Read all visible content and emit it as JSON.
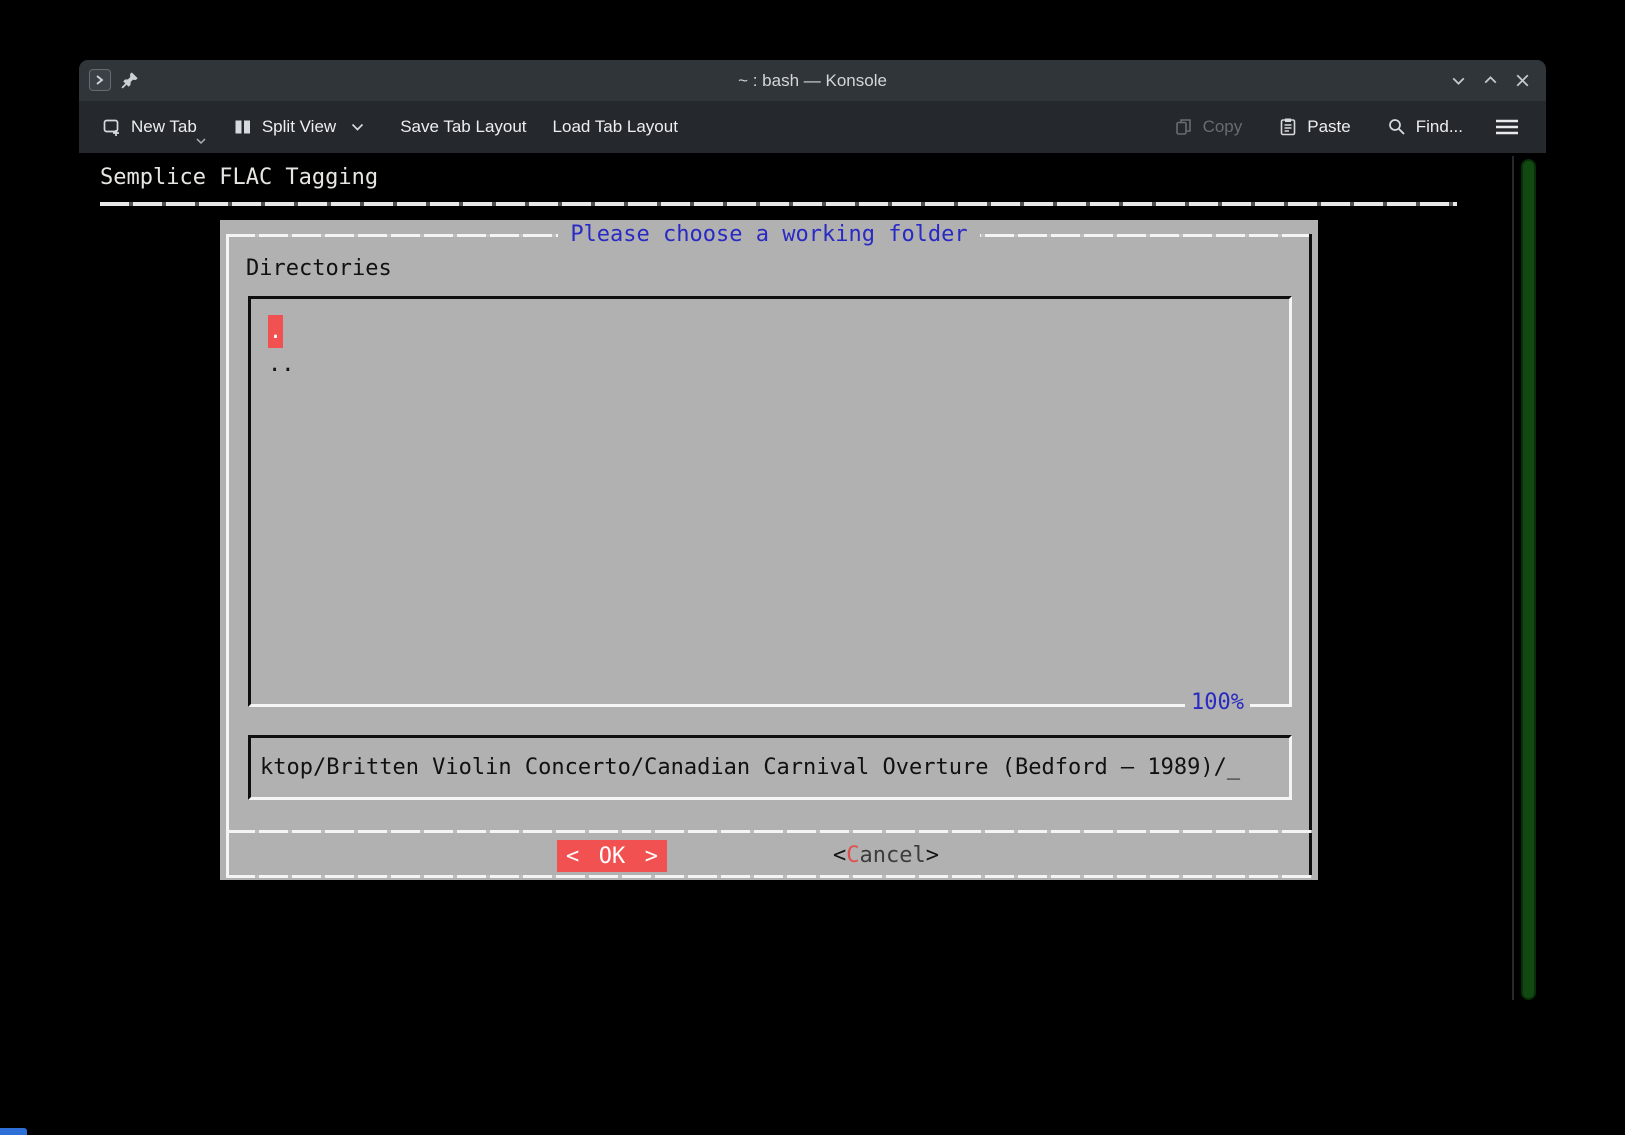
{
  "window": {
    "title": "~ : bash — Konsole"
  },
  "toolbar": {
    "new_tab": "New Tab",
    "split_view": "Split View",
    "save_tab_layout": "Save Tab Layout",
    "load_tab_layout": "Load Tab Layout",
    "copy": "Copy",
    "paste": "Paste",
    "find": "Find..."
  },
  "terminal": {
    "app_header": "Semplice FLAC Tagging",
    "dialog": {
      "title": "Please choose a working folder",
      "directories_label": "Directories",
      "list": {
        "items": [
          ".",
          ".."
        ],
        "selected_index": 0
      },
      "percent_label": "100%",
      "path_input": {
        "value": "ktop/Britten Violin Concerto/Canadian Carnival Overture (Bedford – 1989)/",
        "cursor": "_"
      },
      "buttons": {
        "ok": {
          "bracket_left": "<",
          "label": "OK",
          "bracket_right": ">"
        },
        "cancel": {
          "bracket_left": "<",
          "initial": "C",
          "rest": "ancel",
          "bracket_right": ">"
        }
      }
    }
  },
  "colors": {
    "accent_red": "#f25151",
    "accent_blue": "#2929c3",
    "dialog_gray": "#b1b1b1",
    "scrollbar_green": "#124812",
    "titlebar": "#30353a",
    "toolbar": "#25282c"
  },
  "icons": {
    "app": "konsole-prompt-icon",
    "pin": "pin-icon",
    "new_tab": "new-tab-icon",
    "split_view": "split-view-icon",
    "copy": "copy-icon",
    "paste": "paste-icon",
    "find": "search-icon",
    "menu": "hamburger-menu-icon",
    "minimize": "chevron-down-icon",
    "maximize": "chevron-up-icon",
    "close": "close-icon"
  }
}
